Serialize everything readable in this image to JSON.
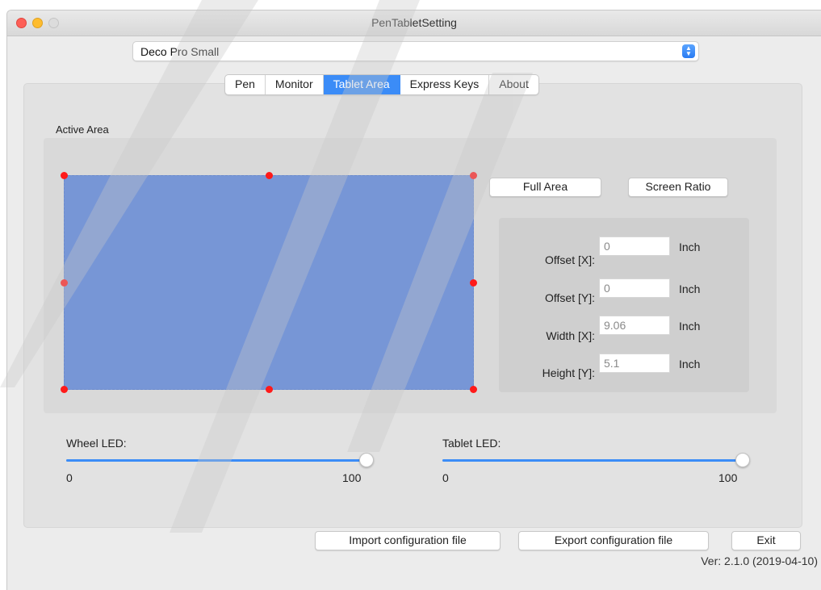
{
  "window": {
    "title": "PenTabletSetting"
  },
  "device_select": {
    "value": "Deco Pro Small"
  },
  "tabs": [
    {
      "label": "Pen",
      "active": false
    },
    {
      "label": "Monitor",
      "active": false
    },
    {
      "label": "Tablet Area",
      "active": true
    },
    {
      "label": "Express Keys",
      "active": false
    },
    {
      "label": "About",
      "active": false
    }
  ],
  "active_area": {
    "section_label": "Active Area",
    "buttons": {
      "full_area": "Full Area",
      "screen_ratio": "Screen Ratio"
    },
    "fields": [
      {
        "label": "Offset [X]:",
        "value": "0",
        "unit": "Inch"
      },
      {
        "label": "Offset [Y]:",
        "value": "0",
        "unit": "Inch"
      },
      {
        "label": "Width [X]:",
        "value": "9.06",
        "unit": "Inch"
      },
      {
        "label": "Height [Y]:",
        "value": "5.1",
        "unit": "Inch"
      }
    ]
  },
  "sliders": {
    "wheel_led": {
      "label": "Wheel LED:",
      "min": "0",
      "max": "100",
      "value": 100
    },
    "tablet_led": {
      "label": "Tablet LED:",
      "min": "0",
      "max": "100",
      "value": 100
    }
  },
  "footer": {
    "import_label": "Import configuration file",
    "export_label": "Export configuration file",
    "exit_label": "Exit",
    "version": "Ver: 2.1.0 (2019-04-10)"
  },
  "colors": {
    "accent": "#3b8cf7",
    "tablet_area_fill": "#7796d6",
    "handle": "#ff1a1a"
  },
  "icons": {
    "close": "traffic-light-close-icon",
    "minimize": "traffic-light-minimize-icon",
    "maximize": "traffic-light-maximize-icon",
    "select_arrows": "updown-chevron-icon"
  }
}
